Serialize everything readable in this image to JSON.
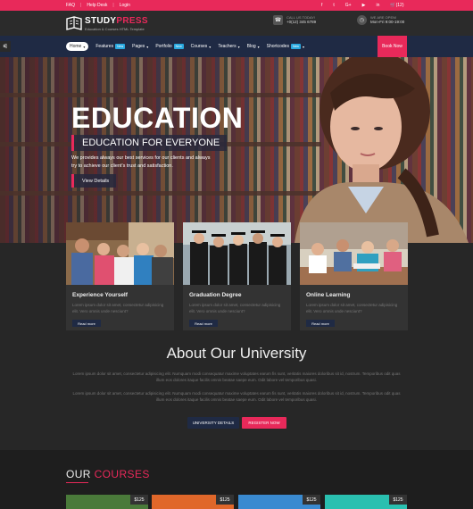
{
  "topbar": {
    "links": [
      "FAQ",
      "Help Desk",
      "Login"
    ],
    "social": [
      "f",
      "t",
      "G+",
      "▶",
      "in",
      "(12)"
    ]
  },
  "header": {
    "logo_study": "STUDY",
    "logo_press": "PRESS",
    "logo_sub": "Education & Courses HTML Template",
    "call_label": "CALL US TODAY!",
    "call_value": "+0(12) 345 6789",
    "open_label": "WE ARE OPEN!",
    "open_value": "Mon-Fri 9:00-19:00"
  },
  "nav": {
    "items": [
      {
        "label": "Home",
        "new": false
      },
      {
        "label": "Features",
        "new": true
      },
      {
        "label": "Pages",
        "new": false
      },
      {
        "label": "Portfolio",
        "new": true
      },
      {
        "label": "Courses",
        "new": false
      },
      {
        "label": "Teachers",
        "new": false
      },
      {
        "label": "Blog",
        "new": false
      },
      {
        "label": "Shortcodes",
        "new": true
      }
    ],
    "new_badge": "New",
    "book_now": "Book Now"
  },
  "hero": {
    "title": "EDUCATION",
    "tagline": "EDUCATION FOR EVERYONE",
    "desc_1": "We provides always our best services for our clients and always",
    "desc_2": "try to achieve our client's trust and satisfaction.",
    "cta": "View Details"
  },
  "cards": [
    {
      "title": "Experience Yourself",
      "text": "Lorem ipsum dolor sit amet, consectetur adipisicing elit. Vero omnis unde nesciunt?",
      "more": "Read more"
    },
    {
      "title": "Graduation Degree",
      "text": "Lorem ipsum dolor sit amet, consectetur adipisicing elit. Vero omnis unde nesciunt?",
      "more": "Read more"
    },
    {
      "title": "Online Learning",
      "text": "Lorem ipsum dolor sit amet, consectetur adipisicing elit. Vero omnis unde nesciunt?",
      "more": "Read more"
    }
  ],
  "about": {
    "title": "About Our University",
    "p1": "Lorem ipsum dolor sit amet, consectetur adipisicing elit. Numquam modi consequatur maxime voluptates earum fis sunt, veritatis maiores doloribus sit id, nostrum. Temporibus odit quas illum eos dolores itaque facilis omnis beatae saepe eum. Odit labore vel temporibus quasi.",
    "p2": "Lorem ipsum dolor sit amet, consectetur adipisicing elit. Numquam modi consequatur maxime voluptates earum fis sunt, veritatis maiores doloribus sit id, nostrum. Temporibus odit quas illum eos dolores itaque facilis omnis beatae saepe eum. Odit labore vel temporibus quasi.",
    "btn_details": "UNIVERSITY DETAILS",
    "btn_register": "REGISTER NOW"
  },
  "courses": {
    "title_our": "OUR",
    "title_courses": "COURSES",
    "prices": [
      "$125",
      "$125",
      "$125",
      "$125"
    ]
  },
  "colors": {
    "accent": "#e8295a",
    "navy": "#1f2a44",
    "dark": "#272727"
  }
}
